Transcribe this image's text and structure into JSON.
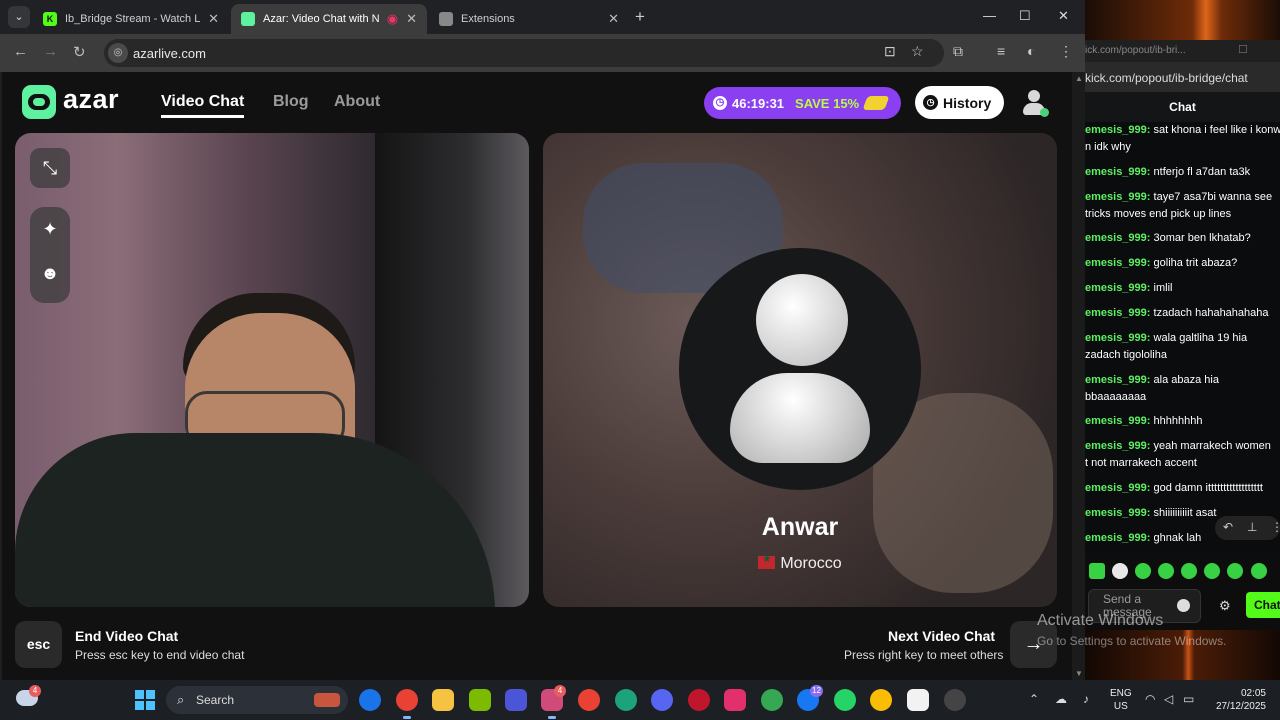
{
  "browser": {
    "tabs": [
      {
        "title": "Ib_Bridge Stream - Watch Live o",
        "favicon": "K"
      },
      {
        "title": "Azar: Video Chat with New F",
        "favicon": "azar"
      },
      {
        "title": "Extensions",
        "favicon": "puzzle"
      }
    ],
    "url": "azarlive.com"
  },
  "azar": {
    "logo": "azar",
    "nav": [
      "Video Chat",
      "Blog",
      "About"
    ],
    "timer": "46:19:31",
    "save": "SAVE 15%",
    "history": "History",
    "partner": {
      "name": "Anwar",
      "country": "Morocco"
    },
    "end": {
      "key": "esc",
      "title": "End Video Chat",
      "sub": "Press esc key to end video chat"
    },
    "next": {
      "key": "→",
      "title": "Next Video Chat",
      "sub": "Press right key to meet others"
    }
  },
  "kick": {
    "popout_title": "ick.com/popout/ib-bri...",
    "url": "kick.com/popout/ib-bridge/chat",
    "header": "Chat",
    "messages": [
      {
        "user": "emesis_999:",
        "text": "sat khona i feel like i konw"
      },
      {
        "user": "",
        "text": "n idk why"
      },
      {
        "user": "emesis_999:",
        "text": "ntferjo fl a7dan ta3k"
      },
      {
        "user": "emesis_999:",
        "text": "taye7 asa7bi wanna see"
      },
      {
        "user": "",
        "text": "tricks moves end pick up lines"
      },
      {
        "user": "emesis_999:",
        "text": "3omar ben lkhatab?"
      },
      {
        "user": "emesis_999:",
        "text": "goliha trit abaza?"
      },
      {
        "user": "emesis_999:",
        "text": "imlil"
      },
      {
        "user": "emesis_999:",
        "text": "tzadach hahahahahaha"
      },
      {
        "user": "emesis_999:",
        "text": "wala galtliha 19 hia"
      },
      {
        "user": "",
        "text": "zadach tigololiha"
      },
      {
        "user": "emesis_999:",
        "text": "ala abaza hia"
      },
      {
        "user": "",
        "text": "bbaaaaaaaa"
      },
      {
        "user": "emesis_999:",
        "text": "hhhhhhhh"
      },
      {
        "user": "emesis_999:",
        "text": "yeah marrakech women"
      },
      {
        "user": "",
        "text": "t not marrakech accent"
      },
      {
        "user": "emesis_999:",
        "text": "god damn itttttttttttttttttt"
      },
      {
        "user": "emesis_999:",
        "text": "shiiiiiiiiiit asat"
      },
      {
        "user": "emesis_999:",
        "text": "ghnak lah"
      }
    ],
    "input_placeholder": "Send a message",
    "send": "Chat"
  },
  "watermark": {
    "title": "Activate Windows",
    "sub": "Go to Settings to activate Windows."
  },
  "taskbar": {
    "search": "Search",
    "lang": "ENG",
    "region": "US",
    "time": "02:05",
    "date": "27/12/2025",
    "badges": {
      "weather": "4",
      "app5": "4",
      "facebook": "12"
    }
  }
}
